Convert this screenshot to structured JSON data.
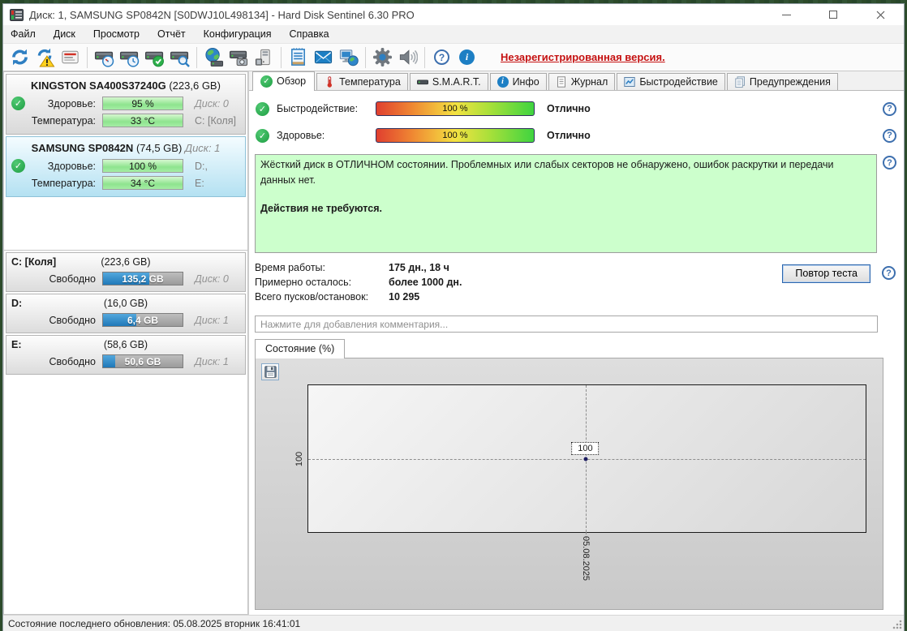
{
  "window": {
    "title": "Диск: 1, SAMSUNG SP0842N [S0DWJ10L498134]  -  Hard Disk Sentinel 6.30 PRO"
  },
  "menu": {
    "items": [
      "Файл",
      "Диск",
      "Просмотр",
      "Отчёт",
      "Конфигурация",
      "Справка"
    ]
  },
  "toolbar": {
    "icons": [
      "refresh-icon",
      "refresh-warning-icon",
      "report-icon",
      "drive-gauge-icon",
      "drive-clock-icon",
      "drive-check-icon",
      "drive-search-icon",
      "network-drive-icon",
      "drive-camera-icon",
      "drive-tower-icon",
      "notes-icon",
      "mail-icon",
      "network-icon",
      "gear-icon",
      "sound-icon",
      "help-icon",
      "info-icon"
    ],
    "unregistered_link": "Незарегистрированная версия."
  },
  "sidebar": {
    "disks": [
      {
        "name": "KINGSTON SA400S37240G",
        "size": "(223,6 GB)",
        "disk_tag": "",
        "health_label": "Здоровье:",
        "health_value": "95 %",
        "right1": "Диск: 0",
        "temp_label": "Температура:",
        "temp_value": "33 °C",
        "right2": "C: [Коля]"
      },
      {
        "name": "SAMSUNG SP0842N",
        "size": "(74,5 GB)",
        "disk_tag": "Диск: 1",
        "health_label": "Здоровье:",
        "health_value": "100 %",
        "right1": "D:,",
        "temp_label": "Температура:",
        "temp_value": "34 °C",
        "right2": "E:"
      }
    ],
    "partitions": [
      {
        "name": "C: [Коля]",
        "size": "(223,6 GB)",
        "free_label": "Свободно",
        "free_value": "135,2 GB",
        "fill_pct": 58,
        "disk": "Диск: 0"
      },
      {
        "name": "D:",
        "size": "(16,0 GB)",
        "free_label": "Свободно",
        "free_value": "6,4 GB",
        "fill_pct": 42,
        "disk": "Диск: 1"
      },
      {
        "name": "E:",
        "size": "(58,6 GB)",
        "free_label": "Свободно",
        "free_value": "50,6 GB",
        "fill_pct": 15,
        "disk": "Диск: 1"
      }
    ]
  },
  "tabs": {
    "overview": "Обзор",
    "temperature": "Температура",
    "smart": "S.M.A.R.T.",
    "info": "Инфо",
    "log": "Журнал",
    "performance": "Быстродействие",
    "alerts": "Предупреждения"
  },
  "overview": {
    "performance_label": "Быстродействие:",
    "performance_value": "100 %",
    "performance_status": "Отлично",
    "health_label": "Здоровье:",
    "health_value": "100 %",
    "health_status": "Отлично",
    "message_line1": "Жёсткий диск в ОТЛИЧНОМ состоянии. Проблемных или слабых секторов не обнаружено, ошибок раскрутки и передачи данных нет.",
    "message_line2": "Действия не требуются.",
    "stats": [
      {
        "label": "Время работы:",
        "value": "175 дн., 18 ч"
      },
      {
        "label": "Примерно осталось:",
        "value": "более 1000 дн."
      },
      {
        "label": "Всего пусков/остановок:",
        "value": "10 295"
      }
    ],
    "retest_button": "Повтор теста",
    "comment_placeholder": "Нажмите для добавления комментария..."
  },
  "chart": {
    "tab": "Состояние (%)",
    "chart_data": {
      "type": "line",
      "title": "Состояние (%)",
      "x": [
        "05.08.2025"
      ],
      "values": [
        100
      ],
      "point_label": "100",
      "y_tick": "100",
      "x_tick": "05.08.2025",
      "grid": "dashed-crosshair"
    }
  },
  "statusbar": {
    "text": "Состояние последнего обновления: 05.08.2025 вторник 16:41:01"
  }
}
